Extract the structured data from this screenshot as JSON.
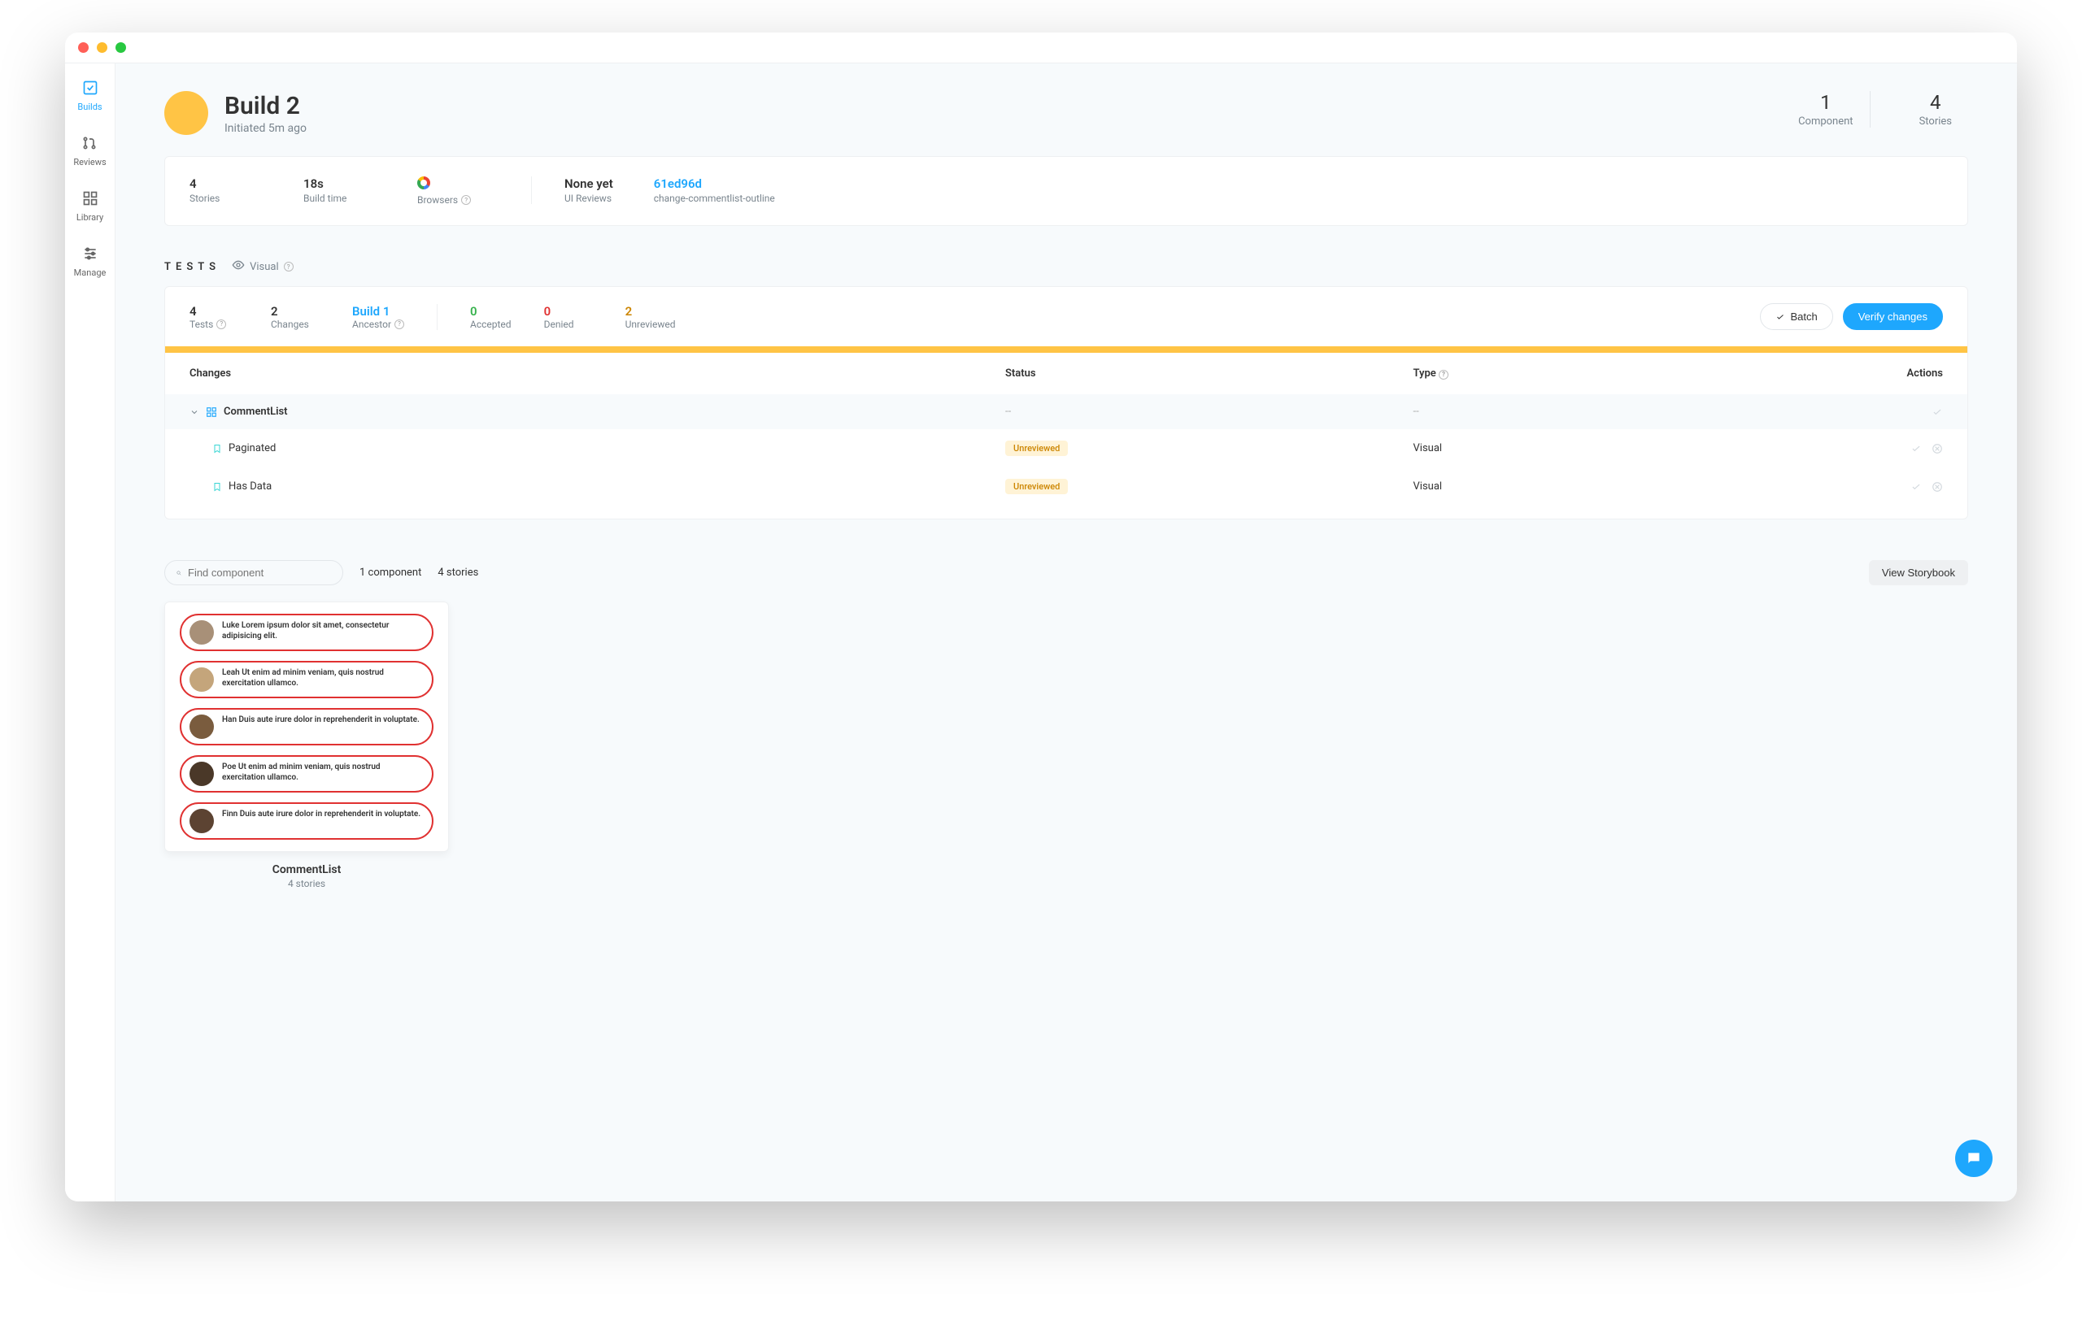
{
  "sidebar": {
    "items": [
      {
        "label": "Builds"
      },
      {
        "label": "Reviews"
      },
      {
        "label": "Library"
      },
      {
        "label": "Manage"
      }
    ]
  },
  "header": {
    "title": "Build 2",
    "subtitle": "Initiated 5m ago",
    "component_count": "1",
    "component_label": "Component",
    "stories_count": "4",
    "stories_label": "Stories"
  },
  "summary": {
    "stories_val": "4",
    "stories_lbl": "Stories",
    "buildtime_val": "18s",
    "buildtime_lbl": "Build time",
    "browsers_lbl": "Browsers",
    "uireviews_val": "None yet",
    "uireviews_lbl": "UI Reviews",
    "commit_hash": "61ed96d",
    "branch": "change-commentlist-outline"
  },
  "tests": {
    "heading": "TESTS",
    "visual_label": "Visual",
    "tests_val": "4",
    "tests_lbl": "Tests",
    "changes_val": "2",
    "changes_lbl": "Changes",
    "ancestor_val": "Build 1",
    "ancestor_lbl": "Ancestor",
    "accepted_val": "0",
    "accepted_lbl": "Accepted",
    "denied_val": "0",
    "denied_lbl": "Denied",
    "unreviewed_val": "2",
    "unreviewed_lbl": "Unreviewed",
    "batch_btn": "Batch",
    "verify_btn": "Verify changes"
  },
  "table": {
    "col_changes": "Changes",
    "col_status": "Status",
    "col_type": "Type",
    "col_actions": "Actions",
    "component_name": "CommentList",
    "empty": "--",
    "rows": [
      {
        "name": "Paginated",
        "status": "Unreviewed",
        "type": "Visual"
      },
      {
        "name": "Has Data",
        "status": "Unreviewed",
        "type": "Visual"
      }
    ]
  },
  "filter": {
    "placeholder": "Find component",
    "components": "1 component",
    "stories": "4 stories",
    "view_storybook": "View Storybook"
  },
  "preview": {
    "name": "CommentList",
    "sub": "4 stories",
    "comments": [
      {
        "text": "Luke Lorem ipsum dolor sit amet, consectetur adipisicing elit."
      },
      {
        "text": "Leah Ut enim ad minim veniam, quis nostrud exercitation ullamco."
      },
      {
        "text": "Han Duis aute irure dolor in reprehenderit in voluptate."
      },
      {
        "text": "Poe Ut enim ad minim veniam, quis nostrud exercitation ullamco."
      },
      {
        "text": "Finn Duis aute irure dolor in reprehenderit in voluptate."
      }
    ]
  }
}
